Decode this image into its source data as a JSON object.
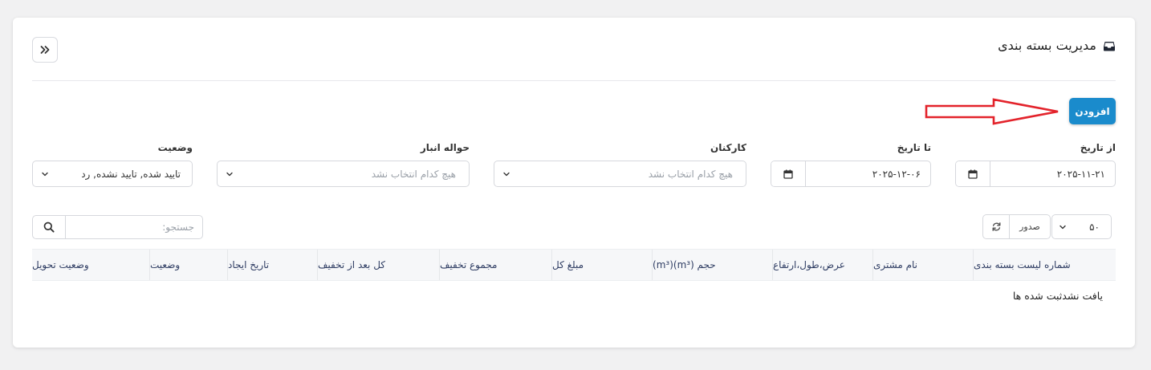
{
  "header": {
    "title": "مدیریت بسته بندی",
    "title_icon": "inbox-icon",
    "collapse_icon": "double-chevron-right-icon"
  },
  "actions": {
    "add_label": "افزودن",
    "add_color": "#1a8bcc",
    "arrow_color": "#e3232b"
  },
  "filters": {
    "from_date": {
      "label": "از تاریخ",
      "value": "۲۰۲۵-۱۱-۲۱"
    },
    "to_date": {
      "label": "تا تاریخ",
      "value": "۲۰۲۵-۱۲-۰۶"
    },
    "employees": {
      "label": "کارکنان",
      "placeholder": "هیچ کدام انتخاب نشد"
    },
    "warehouse": {
      "label": "حواله انبار",
      "placeholder": "هیچ کدام انتخاب نشد"
    },
    "status": {
      "label": "وضعیت",
      "value": "تایید شده, تایید نشده, رد"
    }
  },
  "table_controls": {
    "page_size": "۵۰",
    "export_label": "صدور",
    "search_placeholder": "جستجو:"
  },
  "table": {
    "columns": [
      "شماره لیست بسته بندی",
      "نام مشتری",
      "عرض،طول،ارتفاع",
      "حجم (m³)(m³)",
      "مبلغ کل",
      "مجموع تخفیف",
      "کل بعد از تخفیف",
      "تاریخ ایجاد",
      "وضعیت",
      "وضعیت تحویل"
    ],
    "empty_message": "یافت نشدثبت شده ها"
  }
}
